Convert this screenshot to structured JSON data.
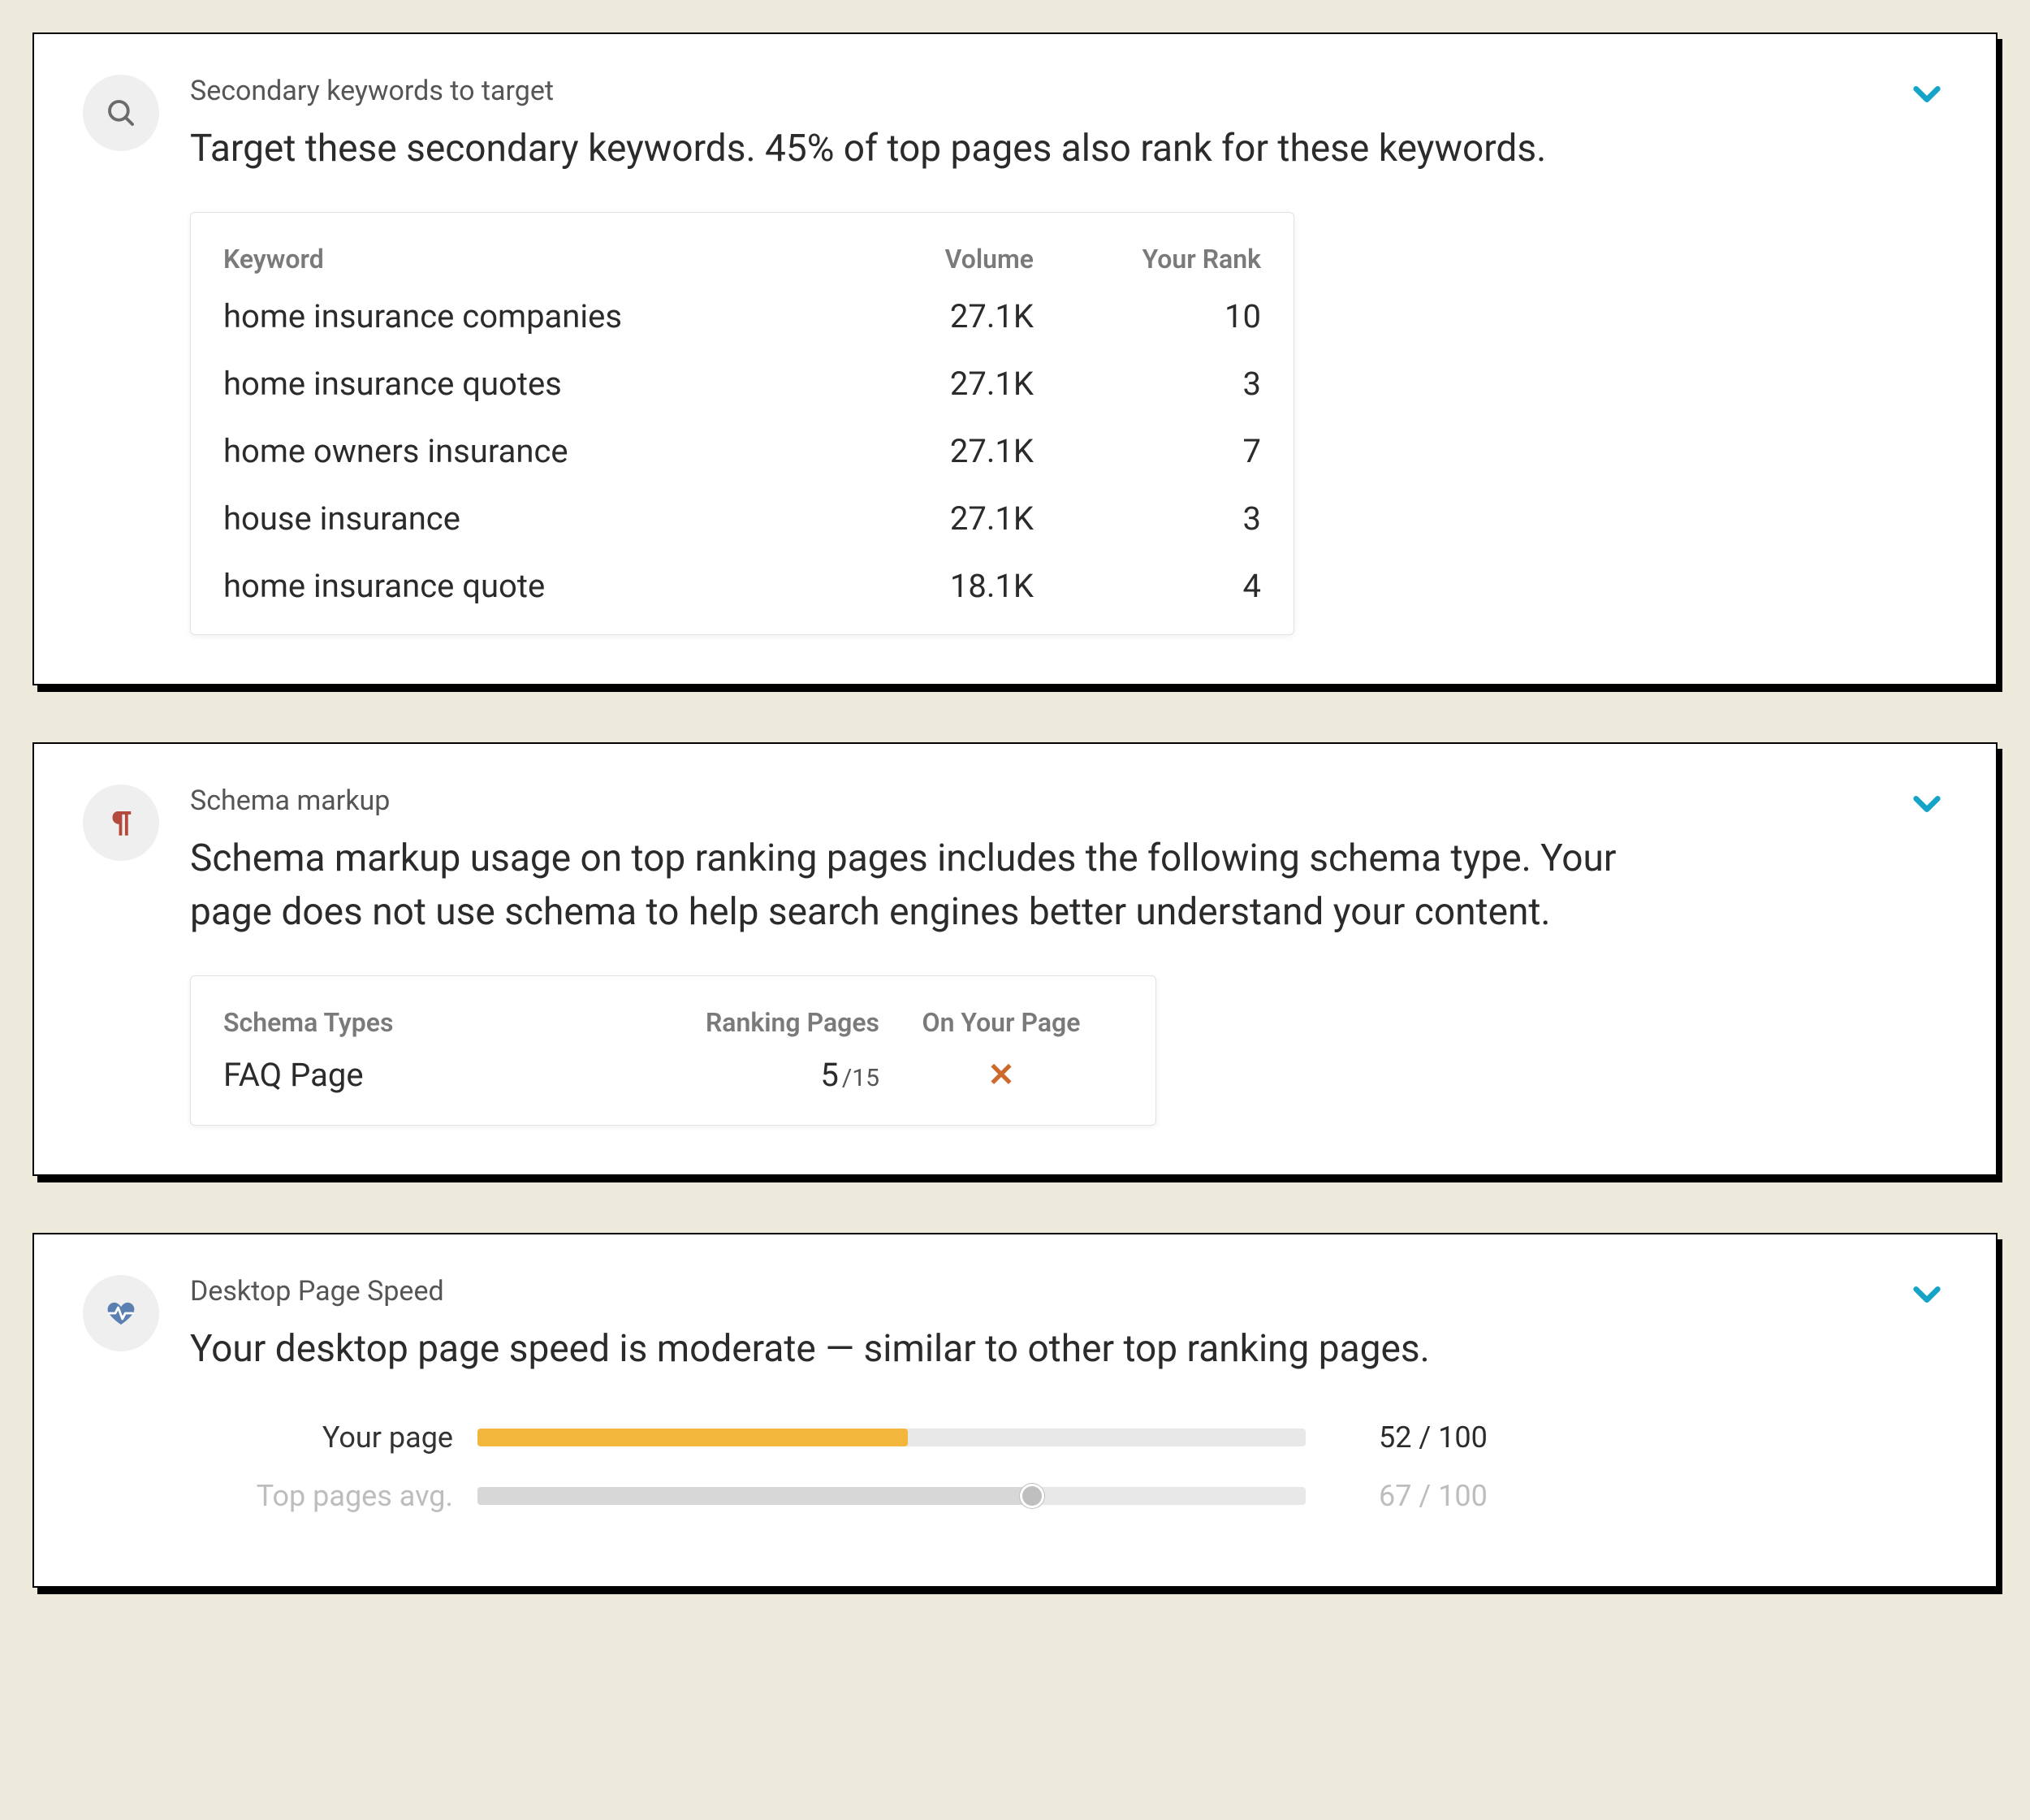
{
  "cards": {
    "keywords": {
      "title": "Secondary keywords to target",
      "desc": "Target these secondary keywords. 45% of top pages also rank for these keywords.",
      "columns": {
        "keyword": "Keyword",
        "volume": "Volume",
        "rank": "Your Rank"
      },
      "rows": [
        {
          "keyword": "home insurance companies",
          "volume": "27.1K",
          "rank": "10"
        },
        {
          "keyword": "home insurance quotes",
          "volume": "27.1K",
          "rank": "3"
        },
        {
          "keyword": "home owners insurance",
          "volume": "27.1K",
          "rank": "7"
        },
        {
          "keyword": "house insurance",
          "volume": "27.1K",
          "rank": "3"
        },
        {
          "keyword": "home insurance quote",
          "volume": "18.1K",
          "rank": "4"
        }
      ]
    },
    "schema": {
      "title": "Schema markup",
      "desc": "Schema markup usage on top ranking pages includes the following schema type. Your page does not use schema to help search engines better understand your content.",
      "columns": {
        "types": "Schema Types",
        "ranking": "Ranking Pages",
        "onyour": "On Your Page"
      },
      "rows": [
        {
          "type": "FAQ Page",
          "count": "5",
          "total": "/15",
          "onpage": false
        }
      ]
    },
    "speed": {
      "title": "Desktop Page Speed",
      "desc": "Your desktop page speed is moderate — similar to other top ranking pages.",
      "rows": [
        {
          "label": "Your page",
          "score": "52 / 100",
          "value": 52,
          "color": "orange"
        },
        {
          "label": "Top pages avg.",
          "score": "67 / 100",
          "value": 67,
          "color": "gray",
          "faded": true,
          "handle": true
        }
      ]
    }
  }
}
